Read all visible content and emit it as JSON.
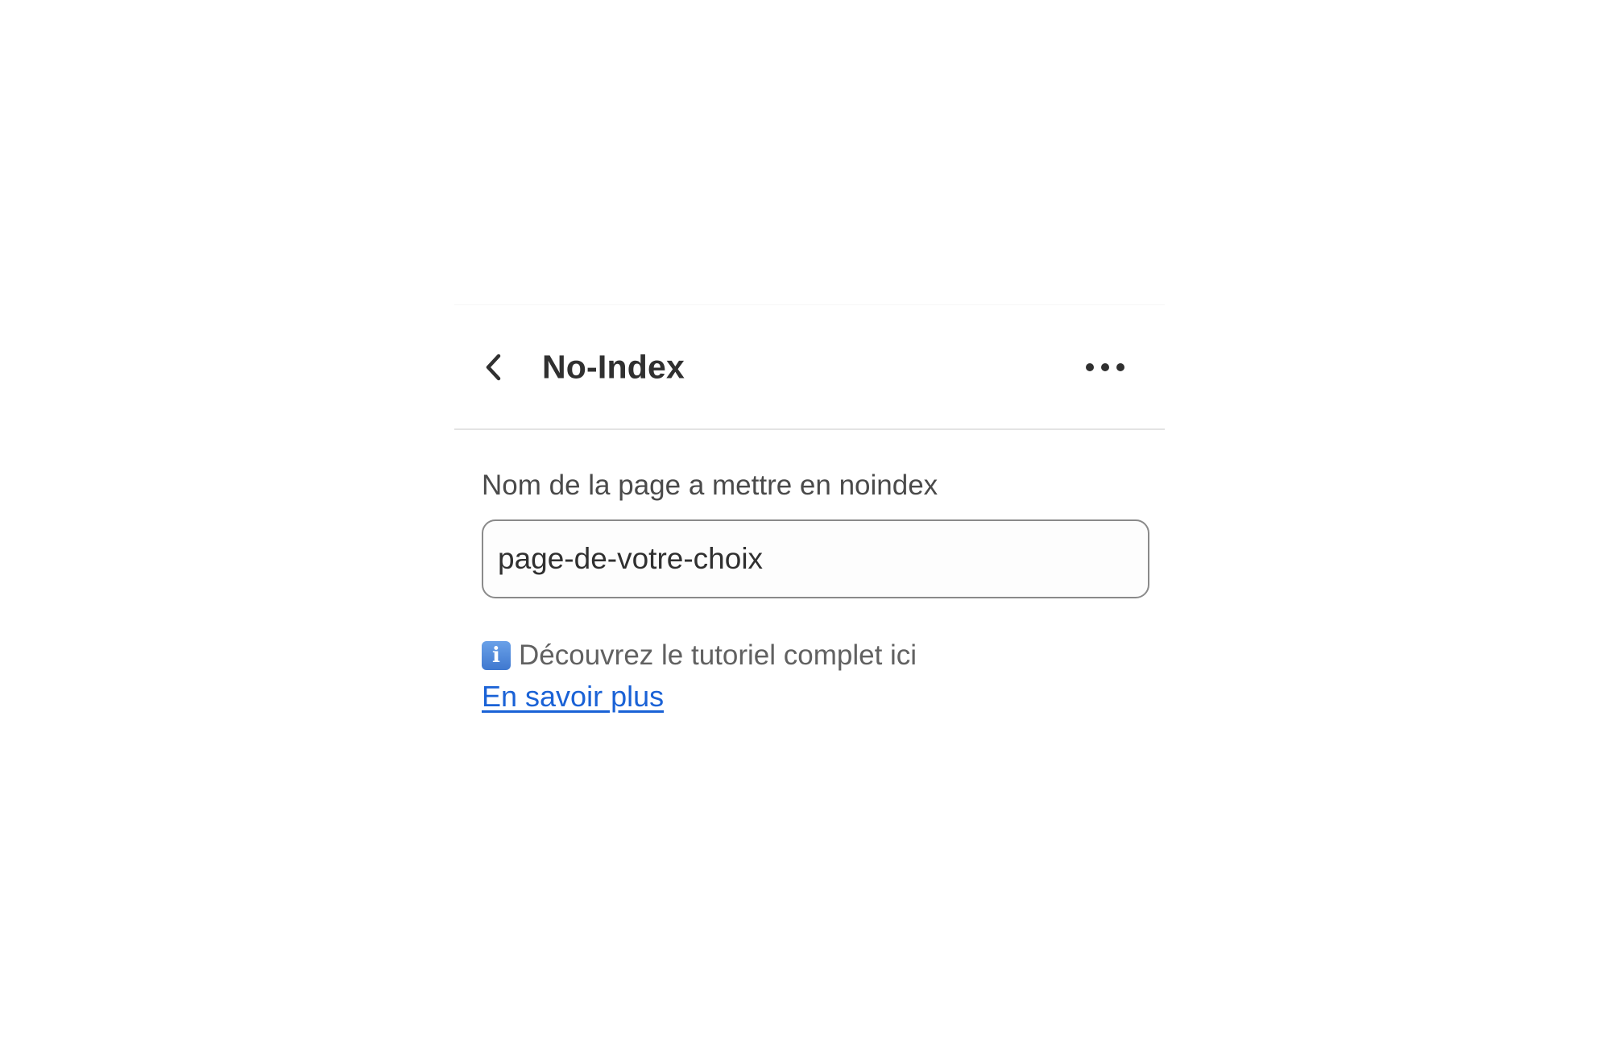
{
  "header": {
    "title": "No-Index",
    "back_icon": "chevron-left-icon",
    "more_icon": "ellipsis-horizontal-icon"
  },
  "form": {
    "field_label": "Nom de la page a mettre en noindex",
    "field_value": "page-de-votre-choix"
  },
  "info": {
    "icon": "information-icon",
    "icon_glyph": "i",
    "text": "Découvrez le tutoriel complet ici",
    "link_label": "En savoir plus"
  },
  "colors": {
    "link": "#1a62d6",
    "text": "#303030",
    "input_border": "#8a8a8a",
    "divider": "#e3e3e3"
  }
}
